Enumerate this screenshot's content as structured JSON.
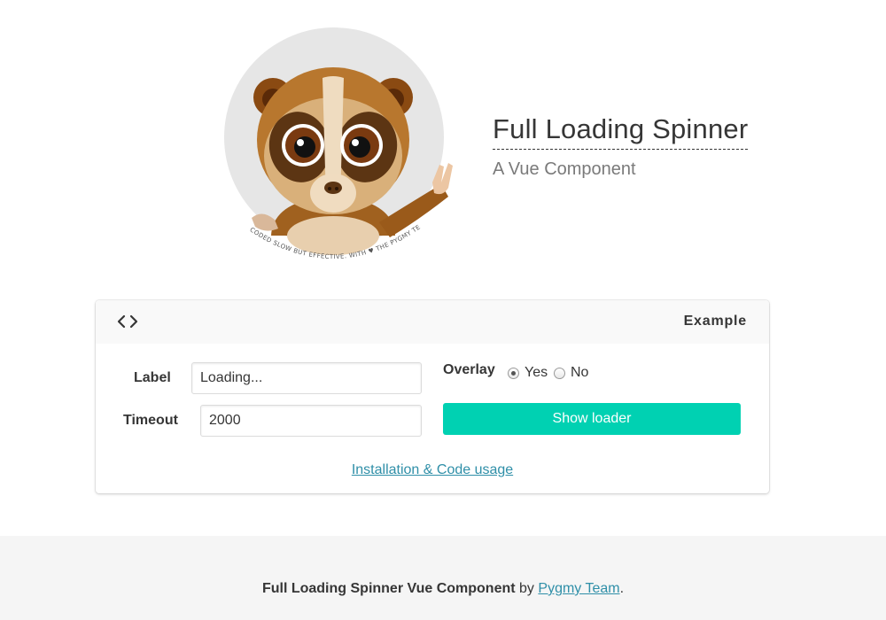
{
  "hero": {
    "title": "Full Loading Spinner",
    "subtitle": "A Vue Component",
    "logo_caption": "CODED SLOW BUT EFFECTIVE. WITH ♥ THE PYGMY TEAM"
  },
  "card": {
    "header_icon": "code-icon",
    "title": "Example",
    "label_field": {
      "label": "Label",
      "value": "Loading..."
    },
    "timeout_field": {
      "label": "Timeout",
      "value": "2000"
    },
    "overlay": {
      "label": "Overlay",
      "options": [
        "Yes",
        "No"
      ],
      "selected": "Yes"
    },
    "button_label": "Show loader",
    "link_text": "Installation & Code usage"
  },
  "footer": {
    "project": "Full Loading Spinner Vue Component",
    "by": "by",
    "team": "Pygmy Team",
    "period": "."
  },
  "colors": {
    "primary": "#00d1b2",
    "link": "#2f8fa8",
    "text": "#363636",
    "muted": "#7a7a7a",
    "footer_bg": "#f5f5f5"
  }
}
